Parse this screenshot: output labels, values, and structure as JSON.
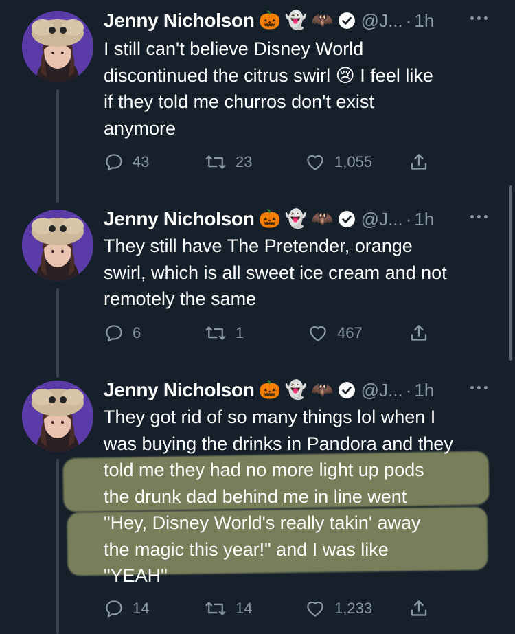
{
  "tweets": [
    {
      "author": {
        "name": "Jenny Nicholson",
        "badges": [
          "🎃",
          "👻",
          "🦇"
        ],
        "handle": "@J...",
        "separator": "·",
        "time": "1h"
      },
      "text_lines": [
        "I still can't believe Disney World",
        "discontinued the citrus swirl 😢 I feel like",
        "if they told me churros don't exist",
        "anymore"
      ],
      "replies": "43",
      "retweets": "23",
      "likes": "1,055"
    },
    {
      "author": {
        "name": "Jenny Nicholson",
        "badges": [
          "🎃",
          "👻",
          "🦇"
        ],
        "handle": "@J...",
        "separator": "·",
        "time": "1h"
      },
      "text_lines": [
        "They still have The Pretender, orange",
        "swirl, which is all sweet ice cream and not",
        "remotely the same"
      ],
      "replies": "6",
      "retweets": "1",
      "likes": "467"
    },
    {
      "author": {
        "name": "Jenny Nicholson",
        "badges": [
          "🎃",
          "👻",
          "🦇"
        ],
        "handle": "@J...",
        "separator": "·",
        "time": "1h"
      },
      "text_lines": [
        "They got rid of so many things lol when I",
        "was buying the drinks in Pandora and they",
        "told me they had no more light up pods",
        "the drunk dad behind me in line went",
        "\"Hey, Disney World's really takin' away",
        "the magic this year!\" and I was like",
        "\"YEAH\""
      ],
      "replies": "14",
      "retweets": "14",
      "likes": "1,233"
    }
  ],
  "colors": {
    "background": "#15202b",
    "secondary_text": "#8b98a5",
    "highlight": "#cbcc82",
    "thread_line": "#38444d"
  }
}
